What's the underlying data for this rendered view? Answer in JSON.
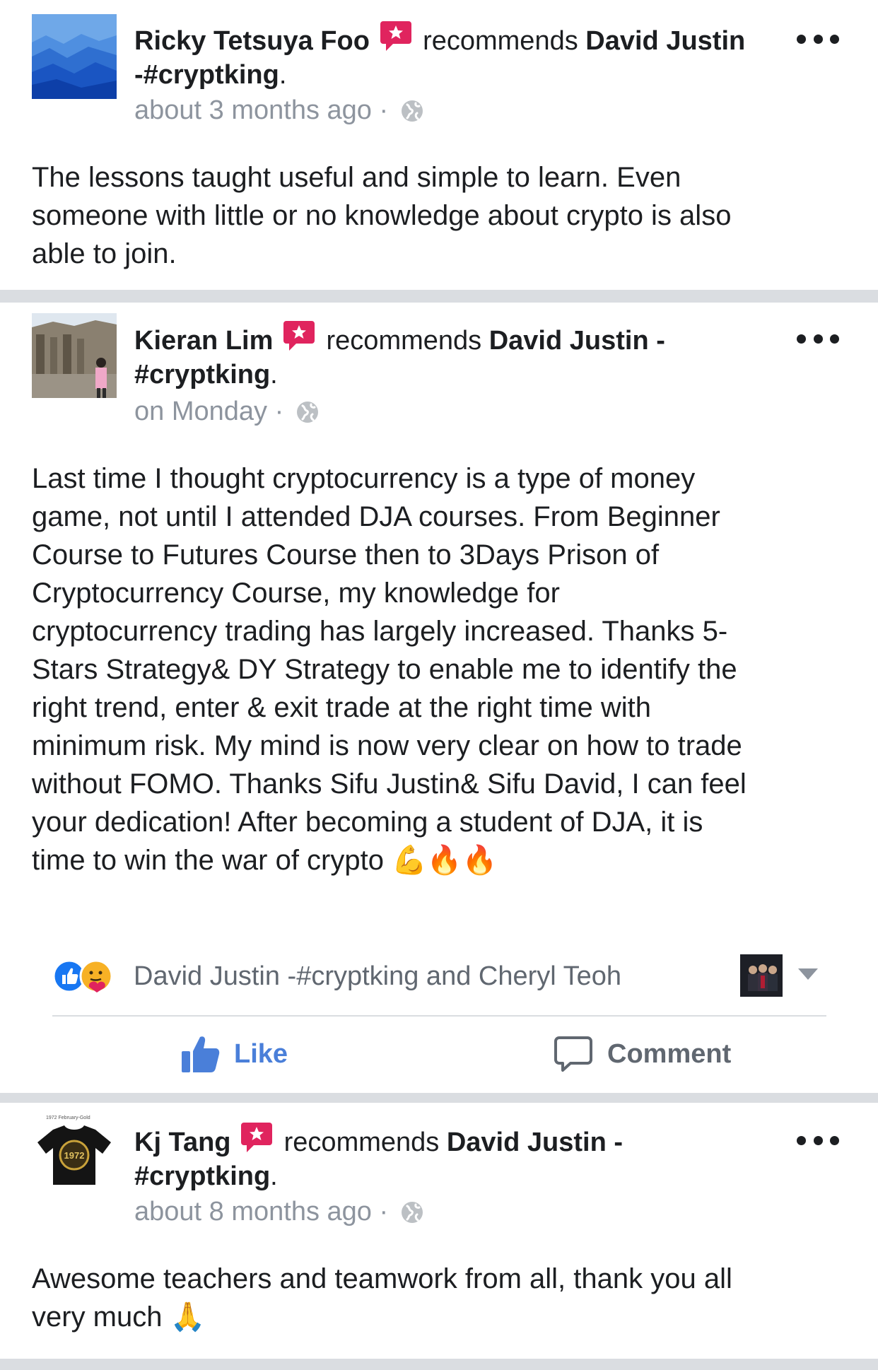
{
  "reviews": [
    {
      "author": "Ricky Tetsuya Foo",
      "verb": "recommends",
      "page_line1": "David Justin",
      "page_line2": "-#cryptking",
      "period": ".",
      "time": "about 3 months ago",
      "dot": "·",
      "text": "The lessons taught useful and simple to learn. Even\nsomeone with little or no knowledge about crypto is also\nable to join."
    },
    {
      "author": "Kieran Lim",
      "verb": "recommends",
      "page_line1": "David Justin -",
      "page_line2": "#cryptking",
      "period": ".",
      "time": "on Monday",
      "dot": "·",
      "text": "Last time I thought cryptocurrency is a type of money\ngame, not until I attended DJA courses. From Beginner\nCourse to Futures Course then to 3Days Prison of\nCryptocurrency Course, my knowledge for\ncryptocurrency trading has largely increased. Thanks 5-\nStars Strategy& DY Strategy to enable me to identify the\nright trend, enter & exit trade at the right time with\nminimum risk. My mind is now very clear on how to trade\nwithout FOMO. Thanks Sifu Justin& Sifu David, I can feel\nyour dedication! After becoming a student of DJA, it is\ntime to win the war of crypto 💪🔥🔥",
      "reactions_text": "David Justin -#cryptking and Cheryl Teoh",
      "like_label": "Like",
      "comment_label": "Comment"
    },
    {
      "author": "Kj Tang",
      "verb": "recommends",
      "page_line1": "David Justin -",
      "page_line2": "#cryptking",
      "period": ".",
      "time": "about 8 months ago",
      "dot": "·",
      "text": "Awesome teachers and teamwork from all, thank you all\nvery much 🙏",
      "avatar_caption": "1972 February-Gold",
      "avatar_shirt_year": "1972"
    }
  ],
  "colors": {
    "text": "#1c1e21",
    "secondary": "#8d949e",
    "recommend_badge": "#e0245e",
    "like_blue": "#4a7fd9",
    "separator": "#dadde1"
  }
}
